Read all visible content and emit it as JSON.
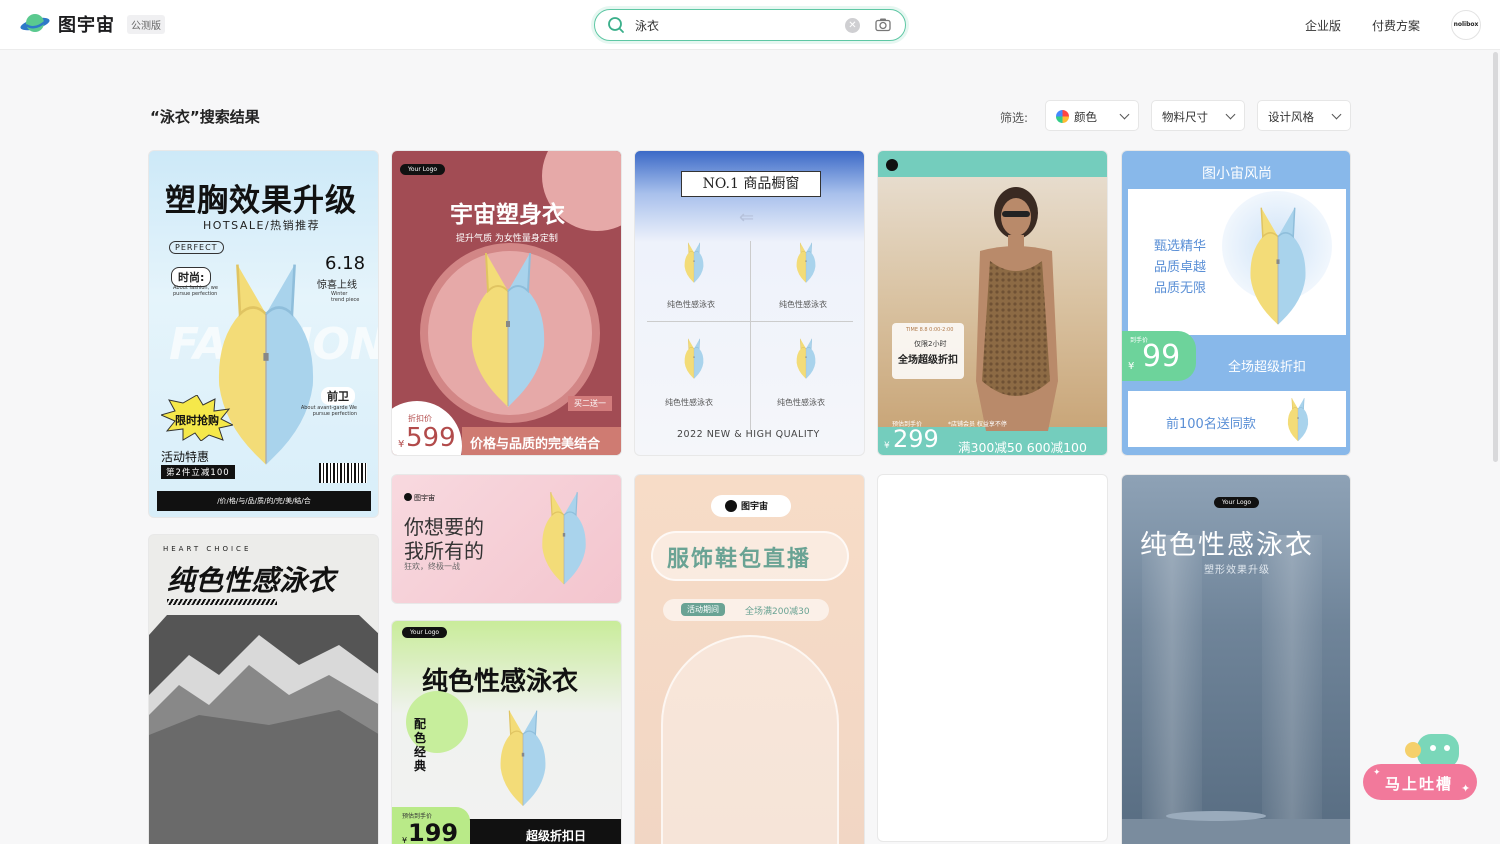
{
  "header": {
    "logo_text": "图宇宙",
    "beta_badge": "公测版",
    "search_value": "泳衣",
    "nav": {
      "enterprise": "企业版",
      "pricing": "付费方案"
    },
    "avatar_text": "nolibox"
  },
  "results": {
    "title": "“泳衣”搜索结果",
    "filter_label": "筛选:",
    "filters": {
      "color": "颜色",
      "size": "物料尺寸",
      "style": "设计风格"
    }
  },
  "cards": {
    "c1": {
      "title": "塑胸效果升级",
      "subtitle": "HOTSALE/热销推荐",
      "perfect": "PERFECT",
      "fashion": "时尚:",
      "fashion_en": "About fashion, we pursue perfection",
      "date": "6.18",
      "launch": "惊喜上线",
      "winter": "Winter trend piece",
      "avant": "前卫",
      "avant_en": "About avant-garde We pursue perfection",
      "flash": "限时抢购",
      "promo": "活动特惠",
      "promo_sub": "第2件立减100",
      "bottom": "/价/格/与/品/质/的/完/美/结/合"
    },
    "c2": {
      "logo": "Your Logo",
      "title": "宇宙塑身衣",
      "subtitle": "提升气质 为女性量身定制",
      "tag": "买二送一",
      "price_label": "折扣价",
      "price": "599",
      "slogan": "价格与品质的完美结合"
    },
    "c3": {
      "title": "NO.1  商品橱窗",
      "labels": [
        "纯色性感泳衣",
        "纯色性感泳衣",
        "纯色性感泳衣",
        "纯色性感泳衣"
      ],
      "footer": "2022 NEW & HIGH QUALITY"
    },
    "c4": {
      "time": "TIME 8.8 0:00-2:00",
      "only": "仅限2小时",
      "sale": "全场超级折扣",
      "presale": "预估到手价",
      "note": "*店铺会员 权益享不停",
      "price": "299",
      "offer": "满300减50 600减100"
    },
    "c5": {
      "brand": "图小宙风尚",
      "lines": [
        "甄选精华",
        "品质卓越",
        "品质无限"
      ],
      "price_label": "到手价",
      "price": "99",
      "sale": "全场超级折扣",
      "gift": "前100名送同款"
    },
    "c6": {
      "heart": "HEART CHOICE",
      "title": "纯色性感泳衣"
    },
    "c7": {
      "brand": "图宇宙",
      "line1": "你想要的",
      "line2": "我所有的",
      "sub": "狂欢，终极一战"
    },
    "c8": {
      "logo": "Your Logo",
      "title": "纯色性感泳衣",
      "side": "配色经典",
      "price_label": "预估到手价",
      "price": "199",
      "tag": "超级折扣日"
    },
    "c9": {
      "brand": "图宇宙",
      "title": "服饰鞋包直播",
      "period": "活动期间",
      "offer": "全场满200减30"
    },
    "c11": {
      "logo": "Your Logo",
      "title": "纯色性感泳衣",
      "subtitle": "塑形效果升级"
    }
  },
  "feedback": {
    "label": "马上吐槽"
  },
  "colors": {
    "accent": "#5ec7a4",
    "feedback": "#f2799b"
  }
}
